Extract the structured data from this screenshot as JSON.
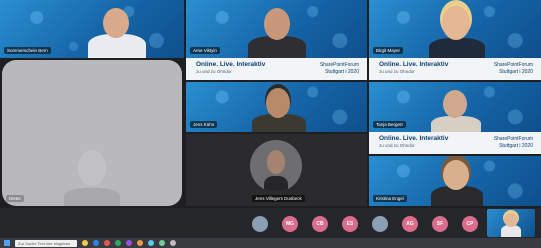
{
  "banner": {
    "line1": "Online. Live. Interaktiv",
    "line2": "zu und zu Ohndor",
    "brand1": "SharePointForum",
    "brand2": "Stuttgart i 2020"
  },
  "participants": {
    "p1": "Sommerschein Bern",
    "p2": "Arne Viktyin",
    "p3": "Birgit Mayer",
    "p4": "Jens Kühn",
    "p5": "Tanja Bergert",
    "p6": "Jens Villegers Dusbeck",
    "p7": "Kristina Engel",
    "p8": "Dieter"
  },
  "avatars": [
    {
      "initials": "",
      "color": "#8aa0b4"
    },
    {
      "initials": "MG",
      "color": "#d96d8b"
    },
    {
      "initials": "CB",
      "color": "#d96d8b"
    },
    {
      "initials": "ES",
      "color": "#d96d8b"
    },
    {
      "initials": "",
      "color": "#8aa0b4"
    },
    {
      "initials": "AG",
      "color": "#d96d8b"
    },
    {
      "initials": "SF",
      "color": "#d96d8b"
    },
    {
      "initials": "CP",
      "color": "#d96d8b"
    }
  ],
  "taskbar": {
    "search_placeholder": "Zur Suche Text hier eingeben"
  }
}
